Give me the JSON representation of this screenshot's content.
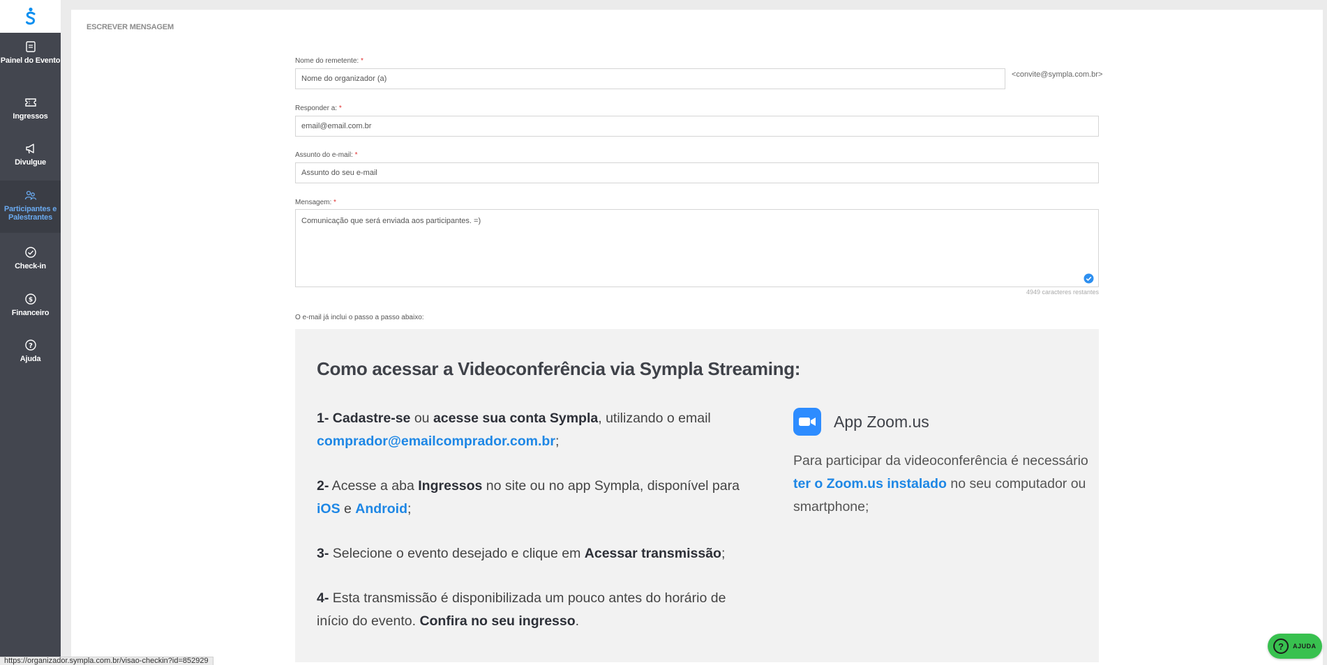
{
  "sidebar": {
    "items": [
      {
        "label": "Painel do Evento",
        "icon": "document-icon"
      },
      {
        "label": "Ingressos",
        "icon": "ticket-icon"
      },
      {
        "label": "Divulgue",
        "icon": "megaphone-icon"
      },
      {
        "label": "Participantes e Palestrantes",
        "icon": "people-icon",
        "active": true
      },
      {
        "label": "Check-in",
        "icon": "check-circle-icon"
      },
      {
        "label": "Financeiro",
        "icon": "money-icon"
      },
      {
        "label": "Ajuda",
        "icon": "question-icon"
      }
    ]
  },
  "page": {
    "title": "ESCREVER MENSAGEM"
  },
  "form": {
    "sender_label": "Nome do remetente:",
    "sender_placeholder": "Nome do organizador (a)",
    "sender_suffix": "<convite@sympla.com.br>",
    "reply_label": "Responder a:",
    "reply_placeholder": "email@email.com.br",
    "subject_label": "Assunto do e-mail:",
    "subject_placeholder": "Assunto do seu e-mail",
    "message_label": "Mensagem:",
    "message_placeholder": "Comunicação que será enviada aos participantes. =)",
    "required_mark": "*",
    "char_count": "4949 caracteres restantes",
    "includes_label": "O e-mail já inclui o passo a passo abaixo:"
  },
  "instructions": {
    "title": "Como acessar a Videoconferência via Sympla Streaming:",
    "step1": {
      "num": "1-",
      "a": "Cadastre-se",
      "b": " ou ",
      "c": "acesse sua conta Sympla",
      "d": ", utilizando o email ",
      "email": "comprador@emailcomprador.com.br",
      "end": ";"
    },
    "step2": {
      "num": "2-",
      "a": " Acesse a aba ",
      "b": "Ingressos",
      "c": " no site ou no app Sympla, disponível para ",
      "ios": "iOS",
      "e": " e ",
      "android": "Android",
      "end": ";"
    },
    "step3": {
      "num": "3-",
      "a": " Selecione o evento desejado e clique em ",
      "b": "Acessar transmissão",
      "end": ";"
    },
    "step4": {
      "num": "4-",
      "a": " Esta transmissão é disponibilizada um pouco antes do horário de início do evento. ",
      "b": "Confira no seu ingresso",
      "end": "."
    },
    "zoom": {
      "title": "App Zoom.us",
      "text_a": "Para participar da videoconferência é necessário ",
      "link": "ter o Zoom.us instalado",
      "text_b": " no seu computador ou smartphone;"
    }
  },
  "status_url": "https://organizador.sympla.com.br/visao-checkin?id=852929",
  "help": {
    "label": "AJUDA",
    "glyph": "?"
  },
  "colors": {
    "sidebar_bg": "#43464f",
    "brand_blue": "#1e87e5",
    "help_green": "#38c14f",
    "required_red": "#e0302f"
  }
}
